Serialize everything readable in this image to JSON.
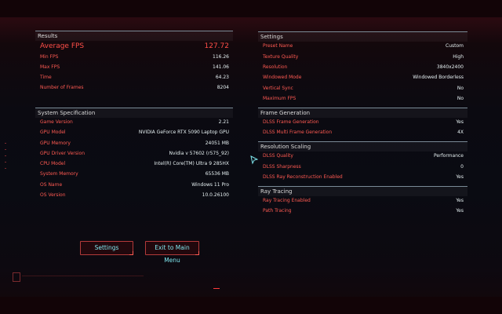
{
  "results": {
    "title": "Results",
    "rows": [
      {
        "label": "Average FPS",
        "value": "127.72"
      },
      {
        "label": "Min FPS",
        "value": "116.26"
      },
      {
        "label": "Max FPS",
        "value": "141.06"
      },
      {
        "label": "Time",
        "value": "64.23"
      },
      {
        "label": "Number of Frames",
        "value": "8204"
      }
    ]
  },
  "system": {
    "title": "System Specification",
    "rows": [
      {
        "label": "Game Version",
        "value": "2.21"
      },
      {
        "label": "GPU Model",
        "value": "NVIDIA GeForce RTX 5090 Laptop GPU"
      },
      {
        "label": "GPU Memory",
        "value": "24051 MB"
      },
      {
        "label": "GPU Driver Version",
        "value": "Nvidia v 57602 (r575_92)"
      },
      {
        "label": "CPU Model",
        "value": "Intel(R) Core(TM) Ultra 9 285HX"
      },
      {
        "label": "System Memory",
        "value": "65536 MB"
      },
      {
        "label": "OS Name",
        "value": "Windows 11 Pro"
      },
      {
        "label": "OS Version",
        "value": "10.0.26100"
      }
    ]
  },
  "settings": {
    "title": "Settings",
    "rows": [
      {
        "label": "Preset Name",
        "value": "Custom"
      },
      {
        "label": "Texture Quality",
        "value": "High"
      },
      {
        "label": "Resolution",
        "value": "3840x2400"
      },
      {
        "label": "Windowed Mode",
        "value": "Windowed Borderless"
      },
      {
        "label": "Vertical Sync",
        "value": "No"
      },
      {
        "label": "Maximum FPS",
        "value": "No"
      }
    ]
  },
  "frame_generation": {
    "title": "Frame Generation",
    "rows": [
      {
        "label": "DLSS Frame Generation",
        "value": "Yes"
      },
      {
        "label": "DLSS Multi Frame Generation",
        "value": "4X"
      }
    ]
  },
  "resolution_scaling": {
    "title": "Resolution Scaling",
    "rows": [
      {
        "label": "DLSS Quality",
        "value": "Performance"
      },
      {
        "label": "DLSS Sharpness",
        "value": "0"
      },
      {
        "label": "DLSS Ray Reconstruction Enabled",
        "value": "Yes"
      }
    ]
  },
  "ray_tracing": {
    "title": "Ray Tracing",
    "rows": [
      {
        "label": "Ray Tracing Enabled",
        "value": "Yes"
      },
      {
        "label": "Path Tracing",
        "value": "Yes"
      }
    ]
  },
  "buttons": {
    "settings": "Settings",
    "exit": "Exit to Main Menu"
  },
  "colors": {
    "label_red": "#ff5a52",
    "value_cyan": "#e6f0f2",
    "button_text": "#7fe7ee"
  }
}
